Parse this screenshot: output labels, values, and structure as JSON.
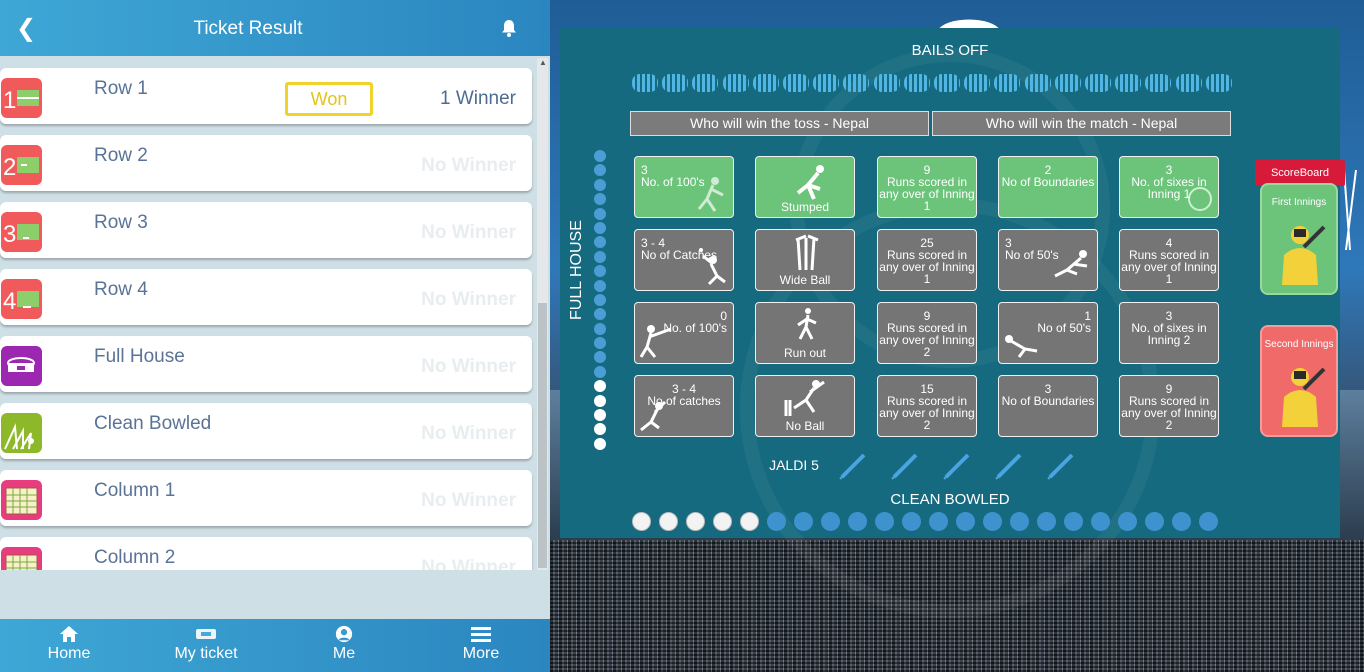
{
  "header": {
    "title": "Ticket Result",
    "back_icon": "back-arrow-icon",
    "bell_icon": "bell-icon"
  },
  "rows": [
    {
      "label": "Row 1",
      "result": "1 Winner",
      "status": "Won",
      "icon": "row-1-icon",
      "icon_color": "#f05a5a"
    },
    {
      "label": "Row 2",
      "result": "No Winner",
      "icon": "row-2-icon",
      "icon_color": "#f05a5a"
    },
    {
      "label": "Row 3",
      "result": "No Winner",
      "icon": "row-3-icon",
      "icon_color": "#f05a5a"
    },
    {
      "label": "Row 4",
      "result": "No Winner",
      "icon": "row-4-icon",
      "icon_color": "#f05a5a"
    },
    {
      "label": "Full House",
      "result": "No Winner",
      "icon": "stadium-icon",
      "icon_color": "#9c27b0"
    },
    {
      "label": "Clean Bowled",
      "result": "No Winner",
      "icon": "stumps-icon",
      "icon_color": "#8cb82a"
    },
    {
      "label": "Column 1",
      "result": "No Winner",
      "icon": "column-1-icon",
      "icon_color": "#e73c7e"
    },
    {
      "label": "Column 2",
      "result": "No Winner",
      "icon": "column-2-icon",
      "icon_color": "#e73c7e"
    }
  ],
  "nav": {
    "home": "Home",
    "ticket": "My ticket",
    "me": "Me",
    "more": "More"
  },
  "board": {
    "bails_off": "BAILS OFF",
    "toss": "Who will win the toss - Nepal",
    "match": "Who will win the match - Nepal",
    "full_house": "FULL HOUSE",
    "jaldi": "JALDI 5",
    "clean_bowled": "CLEAN BOWLED",
    "scoreboard": "ScoreBoard",
    "first_innings": "First Innings",
    "second_innings": "Second Innings",
    "cells": [
      [
        "3\nNo. of 100's",
        "Stumped",
        "9\nRuns scored in any over of Inning 1",
        "2\nNo of Boundaries",
        "3\nNo. of sixes in Inning 1"
      ],
      [
        "3 - 4\nNo of Catches",
        "Wide Ball",
        "25\nRuns scored in any over of Inning 1",
        "3\nNo of 50's",
        "4\nRuns scored in any over of Inning 1"
      ],
      [
        "0\nNo. of 100's",
        "Run out",
        "9\nRuns scored in any over of Inning 2",
        "1\nNo of 50's",
        "3\nNo. of sixes in Inning 2"
      ],
      [
        "3 - 4\nNo of catches",
        "No Ball",
        "15\nRuns scored in any over of Inning 2",
        "3\nNo of Boundaries",
        "9\nRuns scored in any over of Inning 2"
      ]
    ]
  }
}
